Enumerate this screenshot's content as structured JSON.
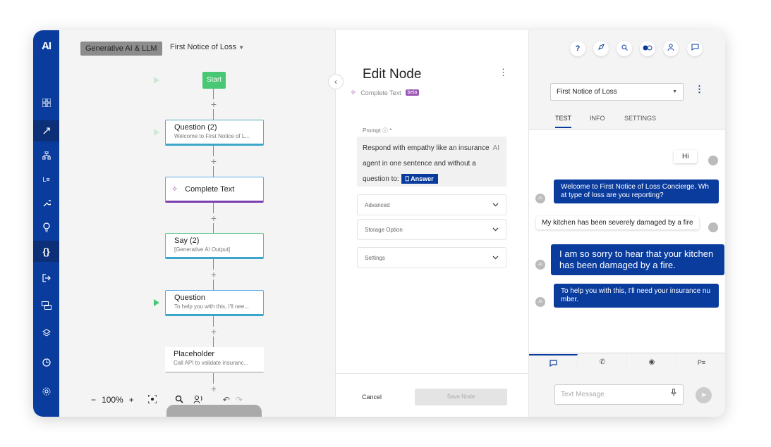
{
  "sidebar": {
    "logo": "AI",
    "icons": [
      "grid-icon",
      "rocket-icon",
      "sitemap-icon",
      "list-icon",
      "wrench-icon",
      "bulb-icon",
      "code-braces-icon",
      "logout-icon",
      "chat-boxes-icon",
      "layers-icon",
      "clock-icon",
      "settings-icon"
    ]
  },
  "canvas": {
    "breadcrumb_tag": "Generative AI & LLM",
    "flow_name": "First Notice of Loss",
    "start_label": "Start",
    "nodes": [
      {
        "title": "Question (2)",
        "subtitle": "Welcome to First Notice of L..."
      },
      {
        "title": "Complete Text",
        "subtitle": ""
      },
      {
        "title": "Say (2)",
        "subtitle": "[Generative AI Output]"
      },
      {
        "title": "Question",
        "subtitle": "To help you with this, I'll nee..."
      },
      {
        "title": "Placeholder",
        "subtitle": "Call API to validate insuranc..."
      }
    ],
    "plus": "+",
    "zoom": {
      "minus": "−",
      "level": "100%",
      "plus": "+"
    }
  },
  "edit": {
    "title": "Edit Node",
    "node_type": "Complete Text",
    "badge": "beta",
    "prompt_label": "Prompt",
    "prompt_required": "*",
    "prompt_text": "Respond with empathy like an insurance agent in one sentence and without a question to:",
    "answer_tag": "Answer",
    "ai_mark": "AI",
    "sections": [
      "Advanced",
      "Storage Option",
      "Settings"
    ],
    "cancel": "Cancel",
    "save": "Save Node"
  },
  "chat": {
    "top_icons": [
      "?",
      "compass-icon",
      "search-icon",
      "toggle-icon",
      "user-icon",
      "chat-icon"
    ],
    "selected_flow": "First Notice of Loss",
    "tabs": [
      "TEST",
      "INFO",
      "SETTINGS"
    ],
    "messages": [
      {
        "from": "user",
        "text": "Hi"
      },
      {
        "from": "bot",
        "text": "Welcome to First Notice of Loss Concierge. Wh at type of loss are you reporting?"
      },
      {
        "from": "user",
        "text": "My kitchen has been severely damaged by a fire"
      },
      {
        "from": "bot",
        "text": "I am so sorry to hear that your kitchen has been damaged by a fire."
      },
      {
        "from": "bot",
        "text": "To help you with this, I'll need your insurance nu mber."
      }
    ],
    "avatar_bot": "AI",
    "bottom_tabs": [
      "chat-icon",
      "phone-icon",
      "record-icon",
      "pe-icon"
    ],
    "input_placeholder": "Text Message"
  },
  "colors": {
    "sidebar": "#0a3c9e",
    "bot_bubble": "#0a3c9e",
    "start": "#48c774",
    "connector": "#3bb36a"
  }
}
